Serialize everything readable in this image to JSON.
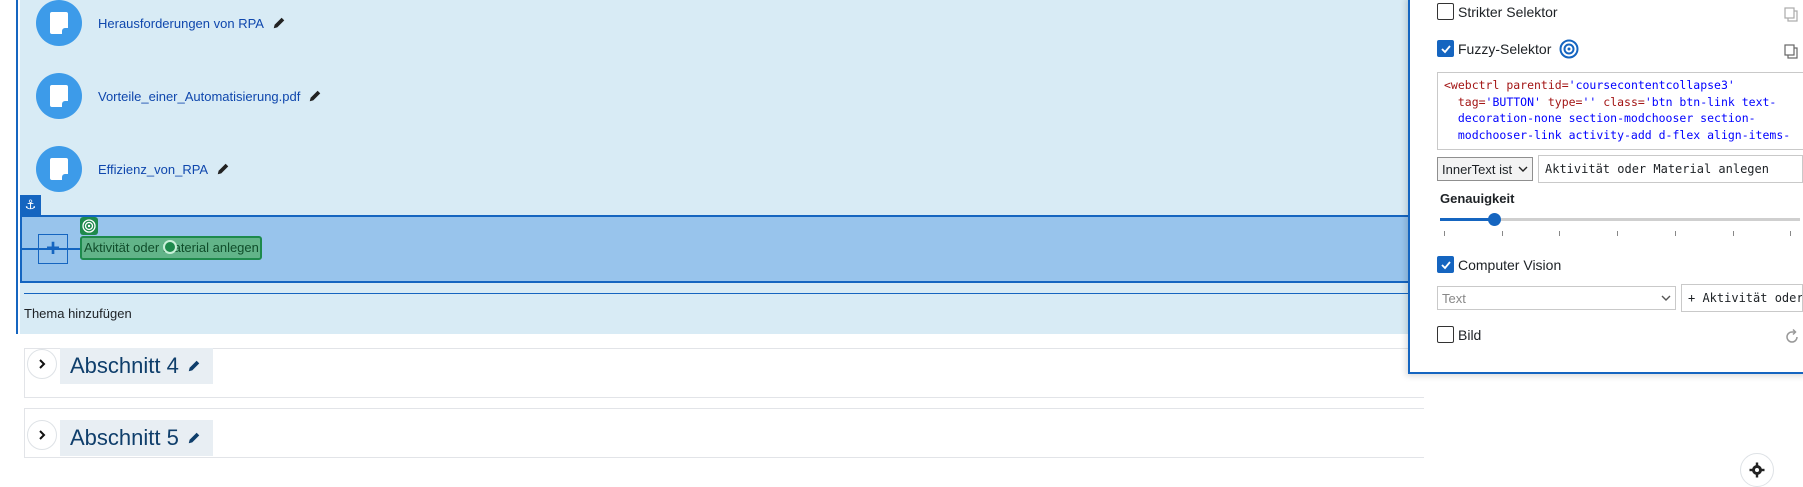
{
  "activities": [
    {
      "name": "Herausforderungen von RPA"
    },
    {
      "name": "Vorteile_einer_Automatisierung.pdf"
    },
    {
      "name": "Effizienz_von_RPA"
    }
  ],
  "add_activity_label": "Aktivität oder Material anlegen",
  "add_topic_label": "Thema hinzufügen",
  "sections": [
    {
      "title": "Abschnitt 4"
    },
    {
      "title": "Abschnitt 5"
    }
  ],
  "panel": {
    "strict_selector_label": "Strikter Selektor",
    "strict_selector_checked": false,
    "fuzzy_selector_label": "Fuzzy-Selektor",
    "fuzzy_selector_checked": true,
    "code_lines": [
      {
        "tag": "<webctrl",
        "rest": " parentid=",
        "val": "'coursecontentcollapse3'"
      },
      {
        "tag": "",
        "rest": "  tag=",
        "val": "'BUTTON'",
        "rest2": " type=",
        "val2": "''",
        "rest3": " class=",
        "val3": "'btn btn-link text-"
      },
      {
        "tag": "",
        "rest": "",
        "val": "  decoration-none section-modchooser section-"
      },
      {
        "tag": "",
        "rest": "",
        "val": "  modchooser-link activity-add d-flex align-items-"
      }
    ],
    "match_mode": "InnerText ist",
    "match_value": "Aktivität oder Material anlegen",
    "accuracy_label": "Genauigkeit",
    "accuracy_value": 0.15,
    "computer_vision_label": "Computer Vision",
    "computer_vision_checked": true,
    "cv_type_placeholder": "Text",
    "cv_text_value": "+ Aktivität oder",
    "image_label": "Bild",
    "image_checked": false
  },
  "colors": {
    "accent": "#1565c0",
    "highlight_green": "#1e8a4c",
    "activity_icon": "#3d9be9"
  }
}
